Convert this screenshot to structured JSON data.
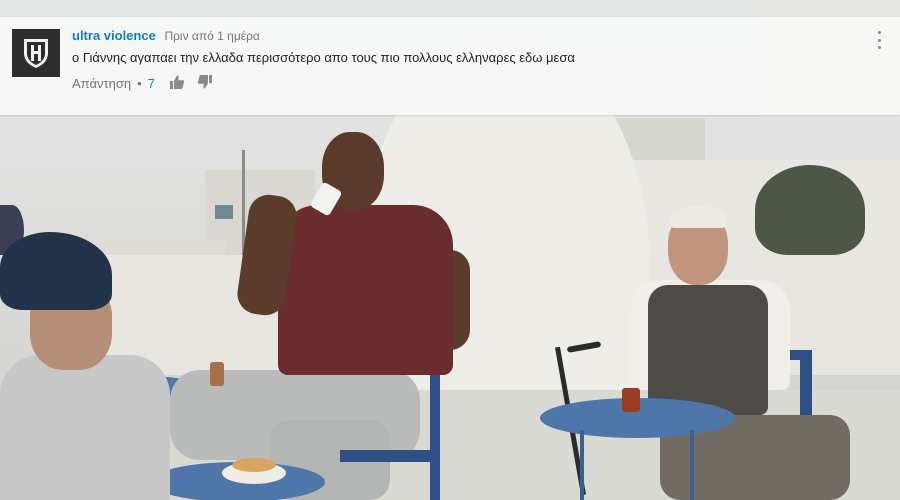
{
  "comment": {
    "author": "ultra violence",
    "timestamp": "Πριν από 1 ημέρα",
    "text": "ο Γιάννης αγαπαει την ελλαδα περισσότερο απο τους πιο πολλους ελληναρες εδω μεσα",
    "reply_label": "Απάντηση",
    "separator": "•",
    "like_count": "7",
    "avatar_icon": "shield-h-icon",
    "like_icon": "thumbs-up-icon",
    "dislike_icon": "thumbs-down-icon",
    "menu_icon": "more-vertical-icon"
  },
  "colors": {
    "author_link": "#167ac6",
    "like_count": "#167ac6",
    "overlay_bg": "#f7f7f7"
  }
}
